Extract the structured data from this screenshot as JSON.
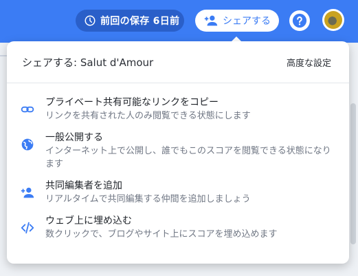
{
  "topbar": {
    "save_status": "前回の保存 6日前",
    "share_label": "シェアする",
    "accent": "#3b7cf4"
  },
  "share_menu": {
    "title": "シェアする: Salut d'Amour",
    "advanced_label": "高度な設定",
    "items": [
      {
        "icon": "link-icon",
        "title": "プライベート共有可能なリンクをコピー",
        "desc": "リンクを共有された人のみ閲覧できる状態にします"
      },
      {
        "icon": "globe-icon",
        "title": "一般公開する",
        "desc": "インターネット上で公開し、誰でもこのスコアを閲覧できる状態になります"
      },
      {
        "icon": "add-person-icon",
        "title": "共同編集者を追加",
        "desc": "リアルタイムで共同編集する仲間を追加しましょう"
      },
      {
        "icon": "code-icon",
        "title": "ウェブ上に埋め込む",
        "desc": "数クリックで、ブログやサイト上にスコアを埋め込めます"
      }
    ]
  }
}
